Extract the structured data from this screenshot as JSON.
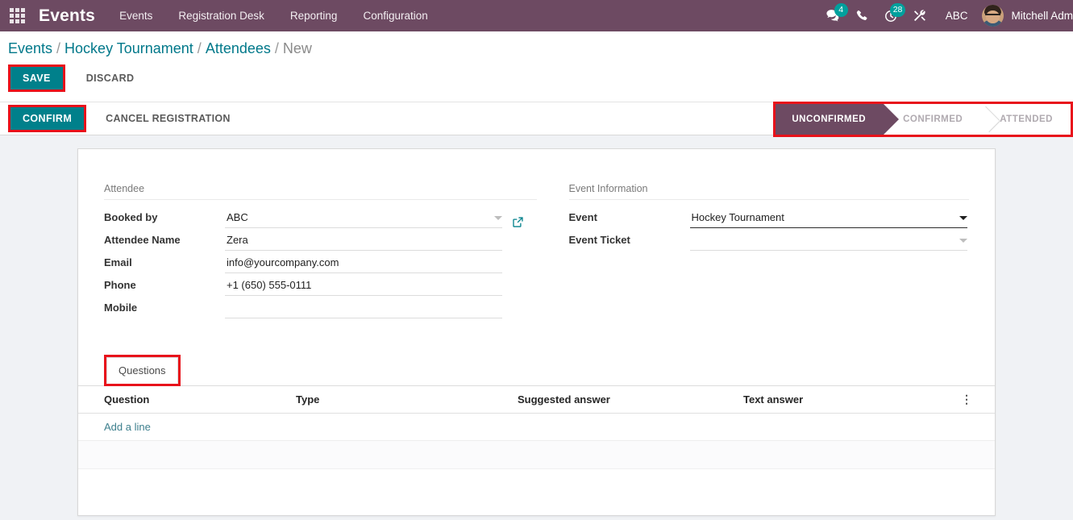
{
  "navbar": {
    "apps_icon": "apps-grid-icon",
    "brand": "Events",
    "menu": [
      {
        "label": "Events"
      },
      {
        "label": "Registration Desk"
      },
      {
        "label": "Reporting"
      },
      {
        "label": "Configuration"
      }
    ],
    "messages_icon": "chat-bubble-icon",
    "messages_count": "4",
    "phone_icon": "phone-icon",
    "activities_icon": "clock-icon",
    "activities_count": "28",
    "debug_icon": "tools-icon",
    "company": "ABC",
    "user_name": "Mitchell Adm",
    "avatar_icon": "user-avatar"
  },
  "breadcrumb": {
    "items": [
      {
        "label": "Events",
        "active": false
      },
      {
        "label": "Hockey Tournament",
        "active": false
      },
      {
        "label": "Attendees",
        "active": false
      },
      {
        "label": "New",
        "active": true
      }
    ],
    "separator": "/"
  },
  "actions": {
    "save_label": "SAVE",
    "discard_label": "DISCARD"
  },
  "statusbar": {
    "confirm_label": "CONFIRM",
    "cancel_registration_label": "CANCEL REGISTRATION",
    "stages": [
      {
        "label": "UNCONFIRMED",
        "active": true
      },
      {
        "label": "CONFIRMED",
        "active": false
      },
      {
        "label": "ATTENDED",
        "active": false
      }
    ]
  },
  "form": {
    "attendee_group": {
      "title": "Attendee",
      "fields": [
        {
          "label": "Booked by",
          "value": "ABC"
        },
        {
          "label": "Attendee Name",
          "value": "Zera"
        },
        {
          "label": "Email",
          "value": "info@yourcompany.com"
        },
        {
          "label": "Phone",
          "value": "+1 (650) 555-0111"
        },
        {
          "label": "Mobile",
          "value": ""
        }
      ]
    },
    "event_group": {
      "title": "Event Information",
      "fields": [
        {
          "label": "Event",
          "value": "Hockey Tournament"
        },
        {
          "label": "Event Ticket",
          "value": ""
        }
      ]
    }
  },
  "notebook": {
    "tabs": [
      {
        "label": "Questions",
        "active": true
      }
    ],
    "table": {
      "columns": [
        "Question",
        "Type",
        "Suggested answer",
        "Text answer"
      ],
      "rows": [],
      "add_line_label": "Add a line",
      "options_icon": "vertical-dots-icon"
    }
  },
  "colors": {
    "navbar_purple": "#6d4a62",
    "accent_teal": "#00808b",
    "badge_teal": "#00a09d",
    "highlight_red": "#e8121b",
    "link_teal": "#00788a",
    "page_bg": "#f0f2f5"
  }
}
